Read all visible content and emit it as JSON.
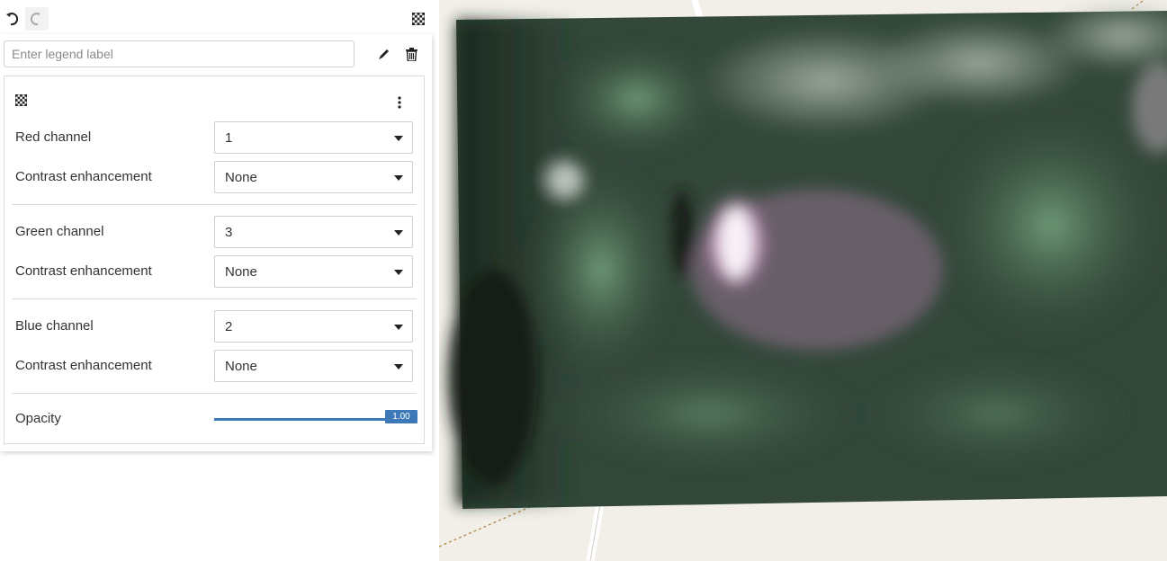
{
  "toolbar": {
    "undo_icon": "undo-icon",
    "redo_icon": "redo-icon",
    "layer_icon": "checkerboard-icon"
  },
  "legend": {
    "placeholder": "Enter legend label",
    "value": ""
  },
  "card": {
    "header_icon": "checkerboard-icon",
    "menu_icon": "kebab-menu-icon",
    "red": {
      "label": "Red channel",
      "value": "1"
    },
    "red_contrast": {
      "label": "Contrast enhancement",
      "value": "None"
    },
    "green": {
      "label": "Green channel",
      "value": "3"
    },
    "green_contrast": {
      "label": "Contrast enhancement",
      "value": "None"
    },
    "blue": {
      "label": "Blue channel",
      "value": "2"
    },
    "blue_contrast": {
      "label": "Contrast enhancement",
      "value": "None"
    },
    "opacity": {
      "label": "Opacity",
      "value": "1.00",
      "fraction": 1.0
    }
  },
  "colors": {
    "accent": "#3d79b8",
    "map_bg": "#f2efe9"
  }
}
